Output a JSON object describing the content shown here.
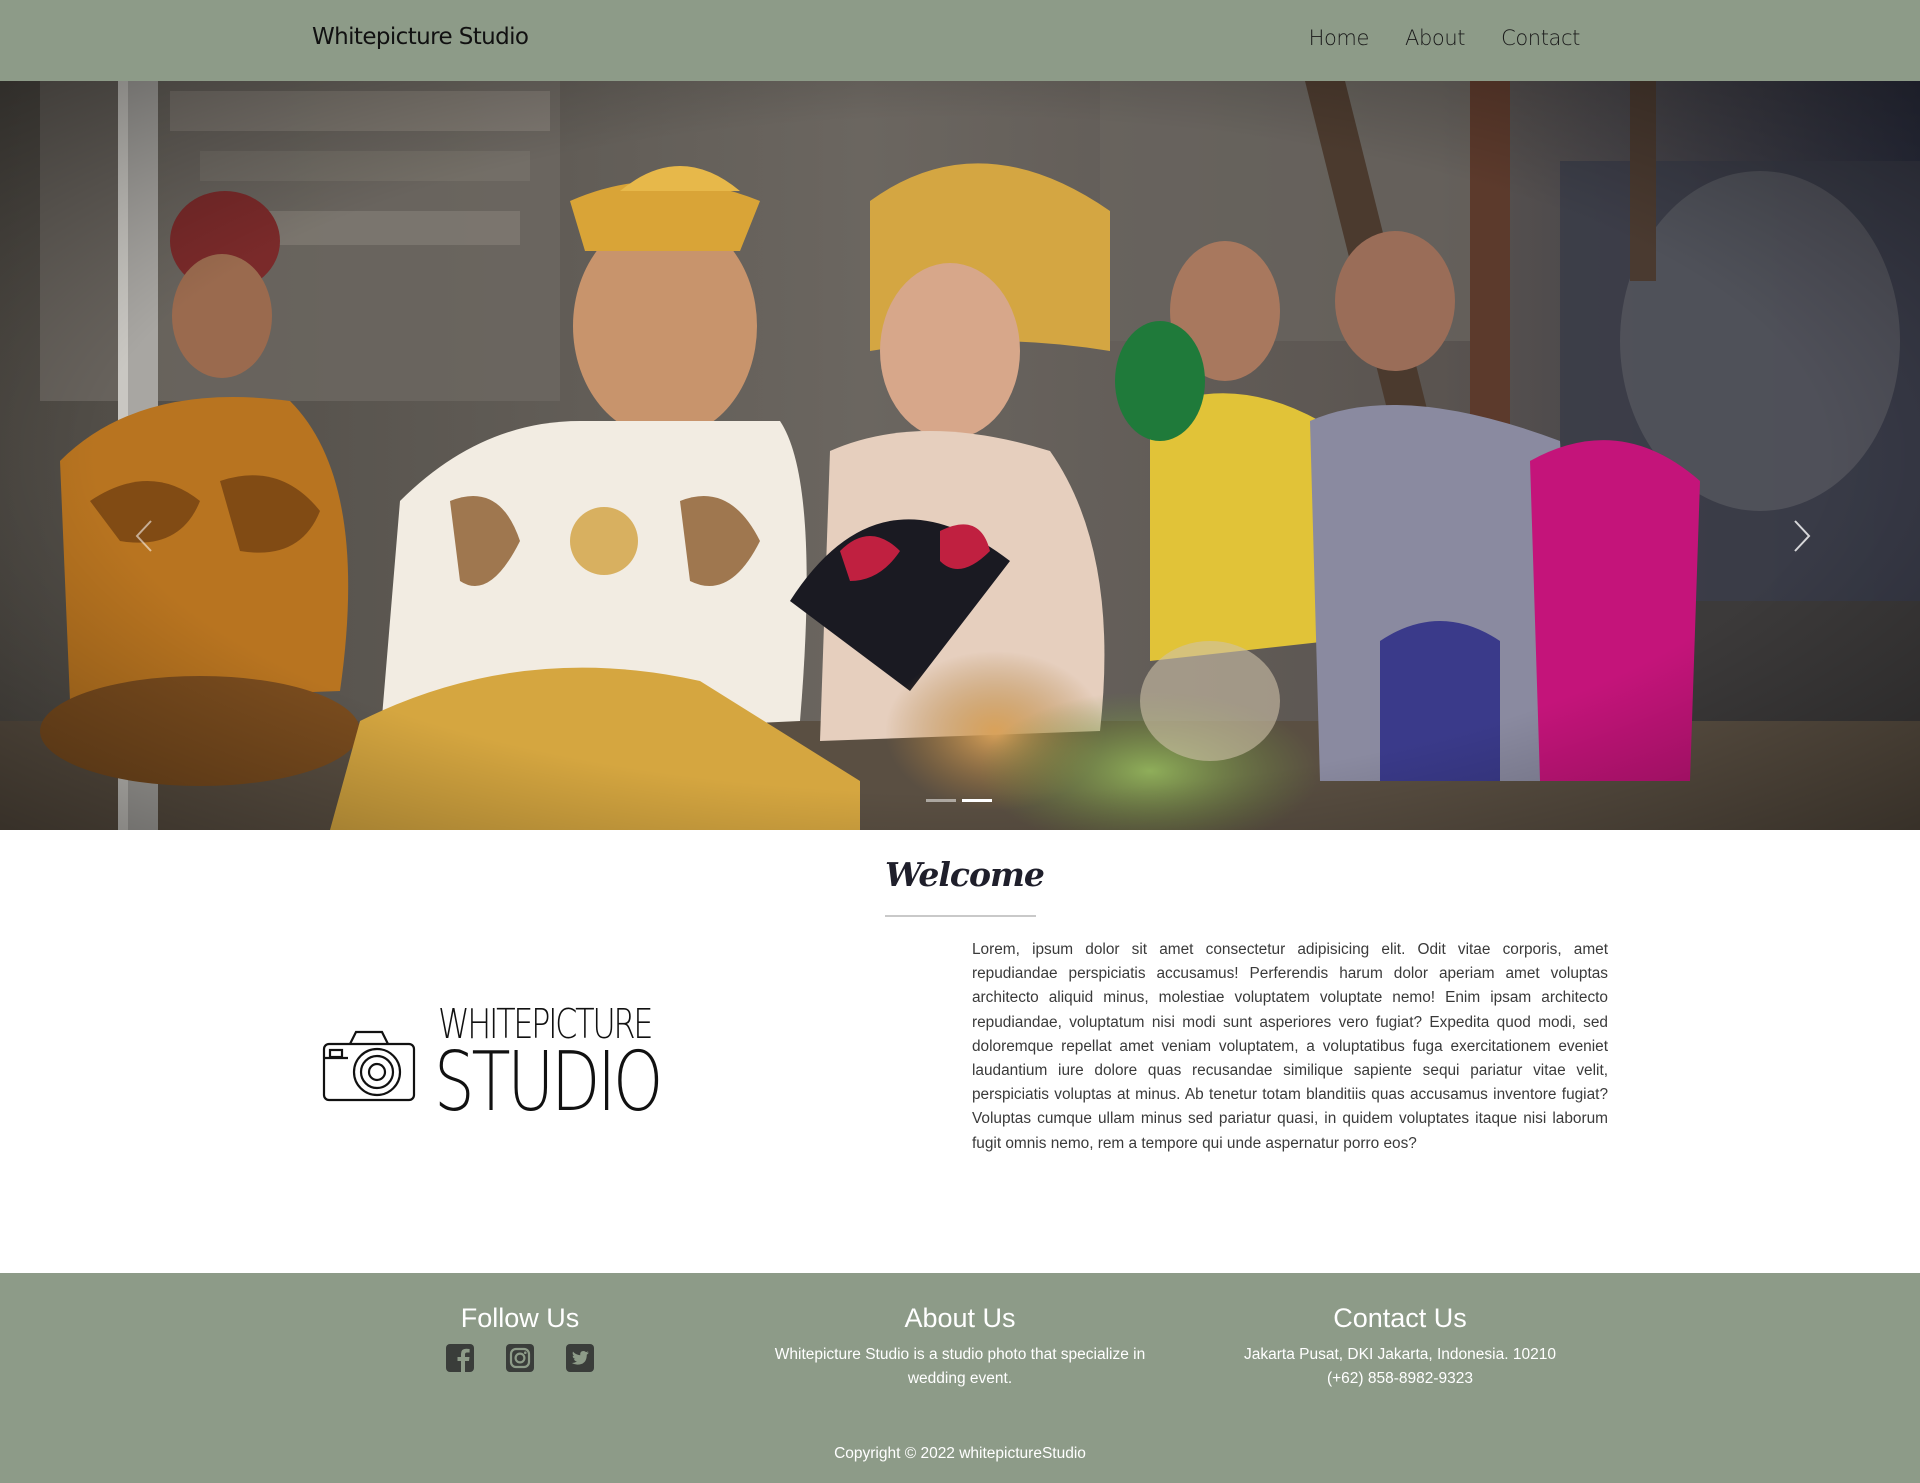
{
  "navbar": {
    "brand": "Whitepicture Studio",
    "links": [
      "Home",
      "About",
      "Contact"
    ]
  },
  "carousel": {
    "slides": 2,
    "active_slide": 2,
    "prev_icon": "chevron-left-icon",
    "next_icon": "chevron-right-icon"
  },
  "about": {
    "logo_line1": "WHITEPICTURE",
    "logo_line2": "STUDIO",
    "welcome_title": "Welcome",
    "welcome_text": "Lorem, ipsum dolor sit amet consectetur adipisicing elit. Odit vitae corporis, amet repudiandae perspiciatis accusamus! Perferendis harum dolor aperiam amet voluptas architecto aliquid minus, molestiae voluptatem voluptate nemo! Enim ipsam architecto repudiandae, voluptatum nisi modi sunt asperiores vero fugiat? Expedita quod modi, sed doloremque repellat amet veniam voluptatem, a voluptatibus fuga exercitationem eveniet laudantium iure dolore quas recusandae similique sapiente sequi pariatur vitae velit, perspiciatis voluptas at minus. Ab tenetur totam blanditiis quas accusamus inventore fugiat? Voluptas cumque ullam minus sed pariatur quasi, in quidem voluptates itaque nisi laborum fugit omnis nemo, rem a tempore qui unde aspernatur porro eos?"
  },
  "footer": {
    "follow_title": "Follow Us",
    "social_icons": [
      "facebook-icon",
      "instagram-icon",
      "twitter-icon"
    ],
    "about_title": "About Us",
    "about_text": "Whitepicture Studio is a studio photo that specialize in wedding event.",
    "contact_title": "Contact Us",
    "contact_address": "Jakarta Pusat, DKI Jakarta, Indonesia. 10210",
    "contact_phone": "(+62) 858-8982-9323",
    "copyright": "Copyright © 2022 whitepictureStudio"
  },
  "colors": {
    "navbar_bg": "#8d9b88",
    "footer_bg": "#8d9b88",
    "page_bg": "#ffffff"
  }
}
